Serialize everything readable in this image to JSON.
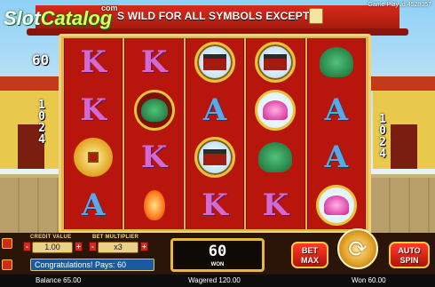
{
  "header": {
    "banner_text": "S WILD FOR ALL SYMBOLS EXCEPT",
    "logo_main": "Slot",
    "logo_accent": "Catalog",
    "logo_com": "com",
    "play_id": "Game Play Id 4528057"
  },
  "side": {
    "left_top_lines": "60",
    "left_ways": [
      "1",
      "0",
      "2",
      "4"
    ],
    "right_ways": [
      "1",
      "0",
      "2",
      "4"
    ]
  },
  "reels": [
    [
      "K",
      "K",
      "gold-coin",
      "A"
    ],
    [
      "K",
      "turtle",
      "K",
      "flame"
    ],
    [
      "gate",
      "A",
      "gate",
      "K"
    ],
    [
      "gate",
      "lotus",
      "turtle-free",
      "K"
    ],
    [
      "turtle-free",
      "A",
      "A",
      "lotus"
    ]
  ],
  "controls": {
    "credit_value_label": "CREDIT VALUE",
    "credit_value": "1.00",
    "bet_multiplier_label": "BET MULTIPLIER",
    "bet_multiplier": "x3",
    "message": "Congratulations! Pays: 60",
    "win_value": "60",
    "win_label": "WON",
    "bet_max_label_1": "BET",
    "bet_max_label_2": "MAX",
    "spin_arrows": "⟳",
    "autospin_label_1": "AUTO",
    "autospin_label_2": "SPIN",
    "minus": "-",
    "plus": "+"
  },
  "status": {
    "balance": "Balance 65.00",
    "wagered": "Wagered 120.00",
    "won": "Won 60.00"
  },
  "colors": {
    "reel_bg": "#b8150c",
    "frame_gold": "#e2b54c",
    "button_red": "#d12a1a"
  }
}
